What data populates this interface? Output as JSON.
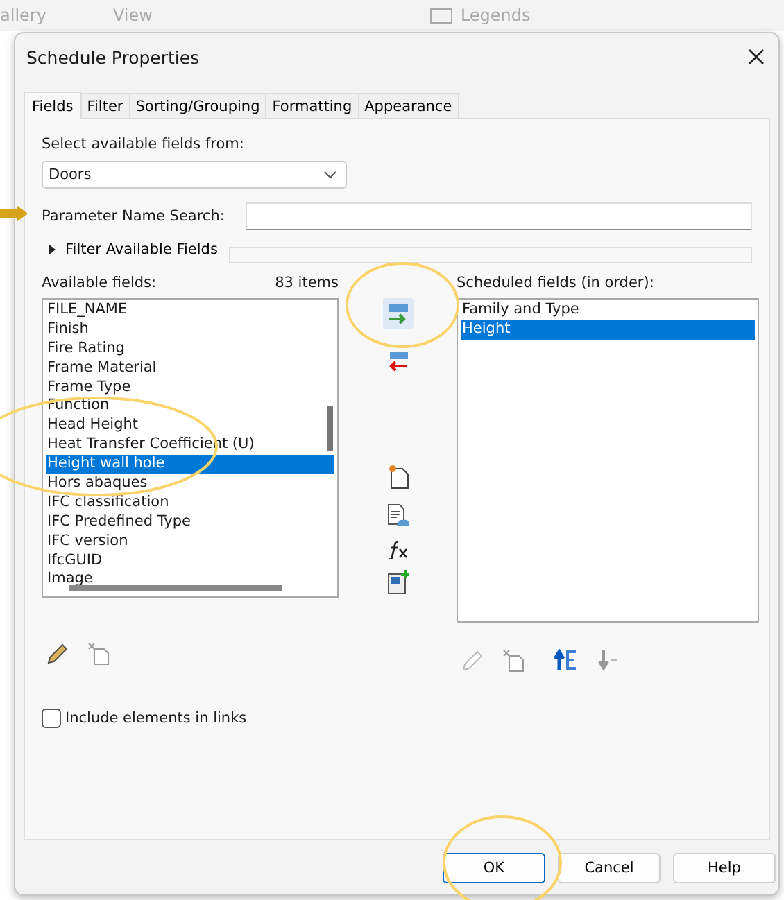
{
  "ribbon": {
    "items": [
      {
        "label": "allery"
      },
      {
        "label": "View"
      },
      {
        "label": "Legends"
      }
    ]
  },
  "window": {
    "title": "Schedule Properties"
  },
  "tabs": [
    {
      "label": "Fields",
      "selected": true
    },
    {
      "label": "Filter",
      "selected": false
    },
    {
      "label": "Sorting/Grouping",
      "selected": false
    },
    {
      "label": "Formatting",
      "selected": false
    },
    {
      "label": "Appearance",
      "selected": false
    }
  ],
  "source": {
    "label": "Select available fields from:",
    "value": "Doors"
  },
  "search": {
    "label": "Parameter Name Search:"
  },
  "filter_expander": {
    "label": "Filter Available Fields",
    "expanded": false
  },
  "available": {
    "label": "Available fields:",
    "count": "83 items",
    "items": [
      {
        "label": "FILE_NAME",
        "selected": false
      },
      {
        "label": "Finish",
        "selected": false
      },
      {
        "label": "Fire Rating",
        "selected": false
      },
      {
        "label": "Frame Material",
        "selected": false
      },
      {
        "label": "Frame Type",
        "selected": false
      },
      {
        "label": "Function",
        "selected": false
      },
      {
        "label": "Head Height",
        "selected": false
      },
      {
        "label": "Heat Transfer Coefficient (U)",
        "selected": false
      },
      {
        "label": "Height wall hole",
        "selected": true
      },
      {
        "label": "Hors abaques",
        "selected": false
      },
      {
        "label": "IFC classification",
        "selected": false
      },
      {
        "label": "IFC Predefined Type",
        "selected": false
      },
      {
        "label": "IFC version",
        "selected": false
      },
      {
        "label": "IfcGUID",
        "selected": false
      },
      {
        "label": "Image",
        "selected": false
      }
    ]
  },
  "scheduled": {
    "label": "Scheduled fields (in order):",
    "items": [
      {
        "label": "Family and Type",
        "selected": false
      },
      {
        "label": "Height",
        "selected": true
      }
    ]
  },
  "include_links": {
    "label": "Include elements in links",
    "checked": false
  },
  "buttons": [
    {
      "label": "OK",
      "default": true
    },
    {
      "label": "Cancel",
      "default": false
    },
    {
      "label": "Help",
      "default": false
    }
  ]
}
